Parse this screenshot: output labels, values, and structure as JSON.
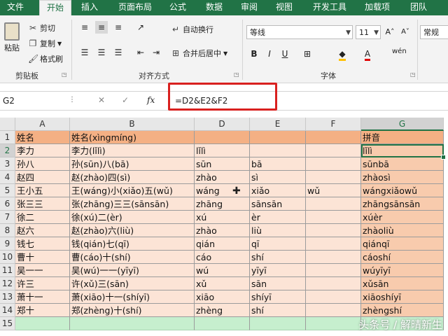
{
  "ribbon_tabs": [
    "文件",
    "开始",
    "插入",
    "页面布局",
    "公式",
    "数据",
    "审阅",
    "视图",
    "开发工具",
    "加载项",
    "团队"
  ],
  "active_tab": "开始",
  "clipboard": {
    "paste": "粘贴",
    "cut": "剪切",
    "copy": "复制",
    "format_painter": "格式刷",
    "group_label": "剪贴板"
  },
  "alignment": {
    "wrap_text": "自动换行",
    "merge_center": "合并后居中",
    "group_label": "对齐方式"
  },
  "font": {
    "name": "等线",
    "size": "11",
    "bold": "B",
    "italic": "I",
    "underline": "U",
    "group_label": "字体",
    "phonetic": "wén"
  },
  "number": {
    "format": "常规"
  },
  "formula_bar": {
    "name_box": "G2",
    "formula": "=D2&E2&F2",
    "fx": "fx"
  },
  "columns": [
    "A",
    "B",
    "D",
    "E",
    "F",
    "G"
  ],
  "selected_column": "G",
  "rows": [
    {
      "n": "1",
      "A": "姓名",
      "B": "姓名(xìngmíng)",
      "D": "",
      "E": "",
      "F": "",
      "G": "拼音"
    },
    {
      "n": "2",
      "A": "李力",
      "B": "李力(lǐlì)",
      "D": "lǐlì",
      "E": "",
      "F": "",
      "G": "lǐlì"
    },
    {
      "n": "3",
      "A": "孙八",
      "B": "孙(sūn)八(bā)",
      "D": "sūn",
      "E": "bā",
      "F": "",
      "G": "sūnbā"
    },
    {
      "n": "4",
      "A": "赵四",
      "B": "赵(zhào)四(sì)",
      "D": "zhào",
      "E": "sì",
      "F": "",
      "G": "zhàosì"
    },
    {
      "n": "5",
      "A": "王小五",
      "B": "王(wáng)小(xiǎo)五(wǔ)",
      "D": "wáng",
      "E": "xiǎo",
      "F": "wǔ",
      "G": "wángxiǎowǔ"
    },
    {
      "n": "6",
      "A": "张三三",
      "B": "张(zhāng)三三(sānsān)",
      "D": "zhāng",
      "E": "sānsān",
      "F": "",
      "G": "zhāngsānsān"
    },
    {
      "n": "7",
      "A": "徐二",
      "B": "徐(xú)二(èr)",
      "D": "xú",
      "E": "èr",
      "F": "",
      "G": "xúèr"
    },
    {
      "n": "8",
      "A": "赵六",
      "B": "赵(zhào)六(liù)",
      "D": "zhào",
      "E": "liù",
      "F": "",
      "G": "zhàoliù"
    },
    {
      "n": "9",
      "A": "钱七",
      "B": "钱(qián)七(qī)",
      "D": "qián",
      "E": "qī",
      "F": "",
      "G": "qiánqī"
    },
    {
      "n": "10",
      "A": "曹十",
      "B": "曹(cáo)十(shí)",
      "D": "cáo",
      "E": "shí",
      "F": "",
      "G": "cáoshí"
    },
    {
      "n": "11",
      "A": "吴一一",
      "B": "吴(wú)一一(yīyī)",
      "D": "wú",
      "E": "yīyī",
      "F": "",
      "G": "wúyīyī"
    },
    {
      "n": "12",
      "A": "许三",
      "B": "许(xǔ)三(sān)",
      "D": "xǔ",
      "E": "sān",
      "F": "",
      "G": "xǔsān"
    },
    {
      "n": "13",
      "A": "萧十一",
      "B": "萧(xiāo)十一(shíyī)",
      "D": "xiāo",
      "E": "shíyī",
      "F": "",
      "G": "xiāoshíyī"
    },
    {
      "n": "14",
      "A": "郑十",
      "B": "郑(zhèng)十(shí)",
      "D": "zhèng",
      "E": "shí",
      "F": "",
      "G": "zhèngshí"
    },
    {
      "n": "15",
      "A": "",
      "B": "",
      "D": "",
      "E": "",
      "F": "",
      "G": ""
    }
  ],
  "watermark": "头条号 / 解晴新生",
  "colors": {
    "excel_green": "#217346",
    "header_fill": "#f4b084",
    "row_fill": "#fce4d6",
    "g_fill": "#f8cbad",
    "row15_fill": "#c6efce",
    "highlight_red": "#d9201f"
  }
}
